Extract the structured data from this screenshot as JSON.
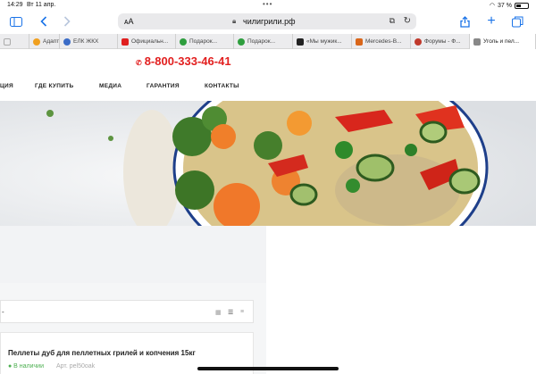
{
  "status_bar": {
    "time": "14:29",
    "date": "Вт 11 апр.",
    "battery": "37 %"
  },
  "browser": {
    "reader_label": "ᴀA",
    "url": "чилигрили.рф",
    "tabs": [
      {
        "label": "",
        "color": "#cccccc"
      },
      {
        "label": "Адапт",
        "color": "#f0a020"
      },
      {
        "label": "ЕЛК ЖКХ",
        "color": "#3b6cc7"
      },
      {
        "label": "Официальн...",
        "color": "#e02020"
      },
      {
        "label": "Подарок...",
        "color": "#2e9e3e"
      },
      {
        "label": "Подарок...",
        "color": "#2e9e3e"
      },
      {
        "label": "«Мы мужик...",
        "color": "#222222"
      },
      {
        "label": "Mercedes-B...",
        "color": "#d9661a"
      },
      {
        "label": "Форумы - Ф...",
        "color": "#c0392b"
      },
      {
        "label": "Уголь и пел...",
        "color": "#888888"
      }
    ]
  },
  "site": {
    "phone": "8-800-333-46-41",
    "nav": [
      "ЦИЯ",
      "ГДЕ КУПИТЬ",
      "МЕДИА",
      "ГАРАНТИЯ",
      "КОНТАКТЫ"
    ],
    "sort_dash": "-",
    "product": {
      "title": "Пеллеты дуб для пеллетных грилей и копчения 15кг",
      "stock": "● В наличии",
      "article": "Арт. pel50oak"
    }
  },
  "colors": {
    "accent": "#e21f1f",
    "browser_blue": "#1a73e8",
    "stock_green": "#4caf50"
  }
}
